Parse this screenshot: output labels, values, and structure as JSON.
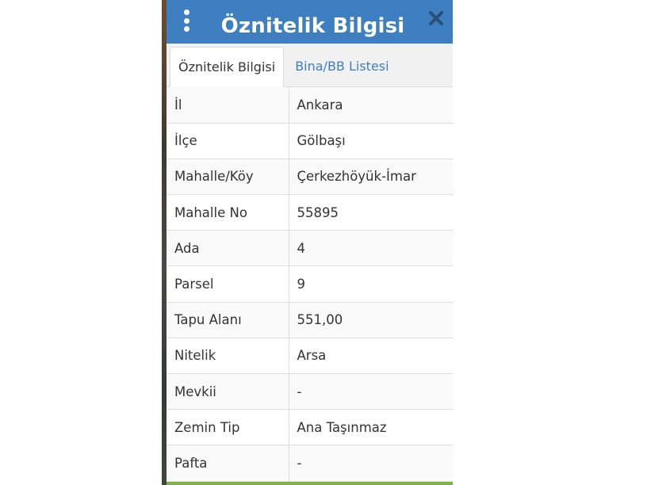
{
  "panel": {
    "title": "Öznitelik Bilgisi",
    "header_color": "#3d7fc1",
    "icons": {
      "menu": "kebab-menu-icon",
      "close": "close-icon"
    }
  },
  "tabs": [
    {
      "label": "Öznitelik Bilgisi",
      "active": true
    },
    {
      "label": "Bina/BB Listesi",
      "active": false
    }
  ],
  "attributes": [
    {
      "key": "İl",
      "value": "Ankara"
    },
    {
      "key": "İlçe",
      "value": "Gölbaşı"
    },
    {
      "key": "Mahalle/Köy",
      "value": "Çerkezhöyük-İmar"
    },
    {
      "key": "Mahalle No",
      "value": "55895"
    },
    {
      "key": "Ada",
      "value": "4"
    },
    {
      "key": "Parsel",
      "value": "9"
    },
    {
      "key": "Tapu Alanı",
      "value": "551,00"
    },
    {
      "key": "Nitelik",
      "value": "Arsa"
    },
    {
      "key": "Mevkii",
      "value": "-"
    },
    {
      "key": "Zemin Tip",
      "value": "Ana Taşınmaz"
    },
    {
      "key": "Pafta",
      "value": "-"
    }
  ]
}
